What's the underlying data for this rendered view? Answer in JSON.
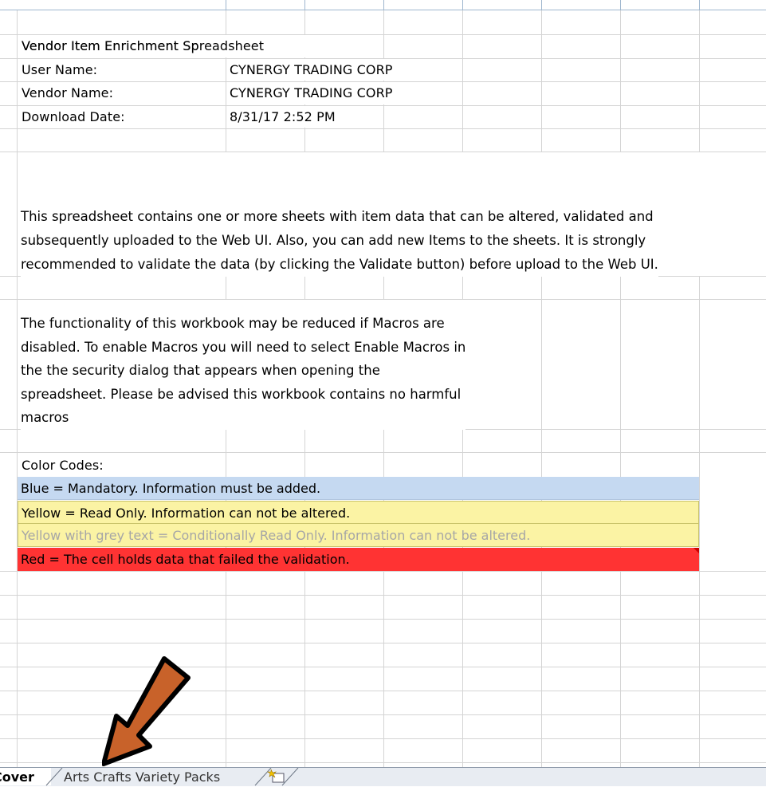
{
  "sheet": {
    "title": "Vendor Item Enrichment Spreadsheet",
    "fields": [
      {
        "label": "User Name:",
        "value": "CYNERGY TRADING CORP"
      },
      {
        "label": "Vendor Name:",
        "value": "CYNERGY TRADING CORP"
      },
      {
        "label": "Download Date:",
        "value": "8/31/17 2:52 PM"
      }
    ],
    "intro_lines": [
      "This spreadsheet contains one or more sheets with item data that can be altered, validated and",
      "subsequently uploaded to the Web UI. Also, you can add new Items to the sheets. It is strongly",
      "recommended to validate the data (by clicking the Validate button) before upload to the Web UI."
    ],
    "macro_lines": [
      "The functionality of this workbook may be reduced if Macros are",
      "disabled. To enable Macros you will need to select Enable Macros in",
      "the  the security dialog that appears when opening the",
      "spreadsheet. Please be advised this workbook contains no harmful",
      "macros"
    ],
    "color_codes_heading": "Color Codes:",
    "color_codes": {
      "blue": "Blue = Mandatory. Information must be added.",
      "yellow": "Yellow = Read Only. Information can not be altered.",
      "grey": "Yellow with grey text = Conditionally Read Only. Information can not be altered.",
      "red": "Red = The cell holds data that failed the validation."
    },
    "colors": {
      "blue": "#c5d9f1",
      "yellow": "#fbf3a4",
      "grey_text": "#a6a6a6",
      "red": "#ff3333",
      "arrow": "#c8622a"
    }
  },
  "tabs": {
    "active": "Cover",
    "sheet2": "Arts Crafts Variety Packs",
    "insert_icon": "insert-sheet-icon"
  },
  "annotation": {
    "arrow_icon": "orange-arrow-icon"
  }
}
